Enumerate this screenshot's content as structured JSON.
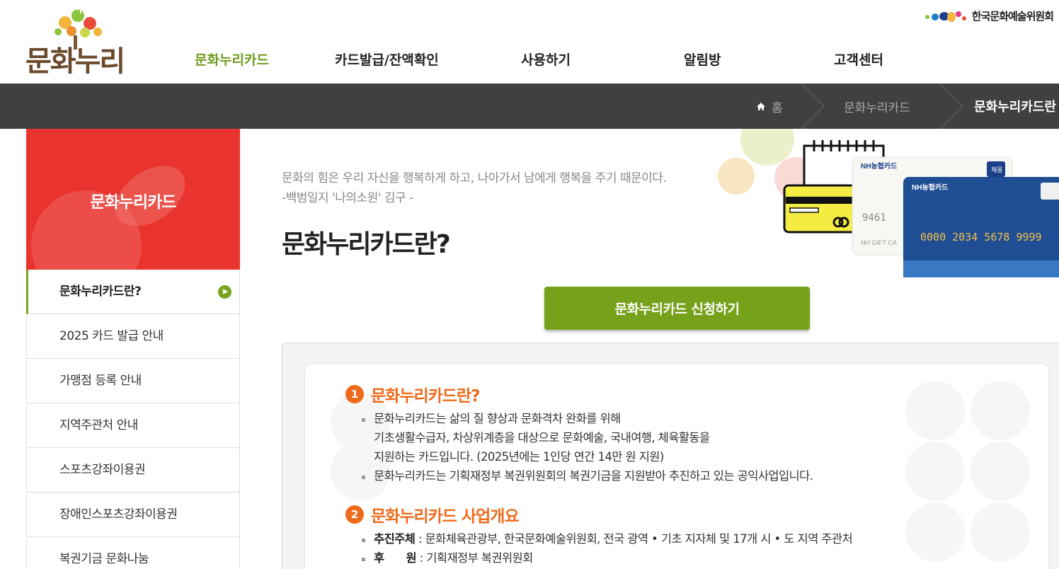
{
  "header": {
    "logo_text": "문화누리",
    "org_name": "한국문화예술위원회",
    "nav": [
      {
        "label": "문화누리카드",
        "active": true
      },
      {
        "label": "카드발급/잔액확인",
        "active": false
      },
      {
        "label": "사용하기",
        "active": false
      },
      {
        "label": "알림방",
        "active": false
      },
      {
        "label": "고객센터",
        "active": false
      }
    ]
  },
  "breadcrumb": {
    "home": "홈",
    "level1": "문화누리카드",
    "current": "문화누리카드란"
  },
  "sidebar": {
    "title": "문화누리카드",
    "items": [
      {
        "label": "문화누리카드란?",
        "active": true
      },
      {
        "label": "2025 카드 발급 안내",
        "active": false
      },
      {
        "label": "가맹점 등록 안내",
        "active": false
      },
      {
        "label": "지역주관처 안내",
        "active": false
      },
      {
        "label": "스포츠강좌이용권",
        "active": false
      },
      {
        "label": "장애인스포츠강좌이용권",
        "active": false
      },
      {
        "label": "복권기금 문화나눔",
        "active": false
      }
    ]
  },
  "main": {
    "quote_line1": "문화의 힘은 우리 자신을 행복하게 하고, 나아가서 남에게 행복을 주기 때문이다.",
    "quote_line2": "-백범일지 '나의소원' 김구 -",
    "title": "문화누리카드란?",
    "apply_button": "문화누리카드 신청하기",
    "cards": {
      "brand": "NH농협카드",
      "card_number": "0000 2034 5678 9999",
      "back_number": "9461",
      "badge": "채움",
      "gift_text": "NH GIFT CA"
    },
    "sections": [
      {
        "num": "1",
        "title": "문화누리카드란?",
        "lines": [
          "문화누리카드는 삶의 질 향상과 문화격차 완화를 위해",
          "기초생활수급자, 차상위계층을 대상으로 문화예술, 국내여행, 체육활동을",
          "지원하는 카드입니다. (2025년에는 1인당 연간 14만 원 지원)",
          "문화누리카드는 기획재정부 복권위원회의 복권기금을 지원받아 추진하고 있는 공익사업입니다."
        ]
      },
      {
        "num": "2",
        "title": "문화누리카드 사업개요",
        "rows": [
          {
            "key": "추진주체",
            "value": " : 문화체육관광부, 한국문화예술위원회, 전국 광역 • 기초 지자체 및 17개 시 • 도 지역 주관처"
          },
          {
            "key": "후      원",
            "value": " : 기획재정부 복권위원회"
          }
        ]
      }
    ]
  },
  "colors": {
    "accent_green": "#76a11b",
    "sidebar_red": "#e8332f",
    "section_orange": "#ef6a1b",
    "locbar": "#404040"
  }
}
